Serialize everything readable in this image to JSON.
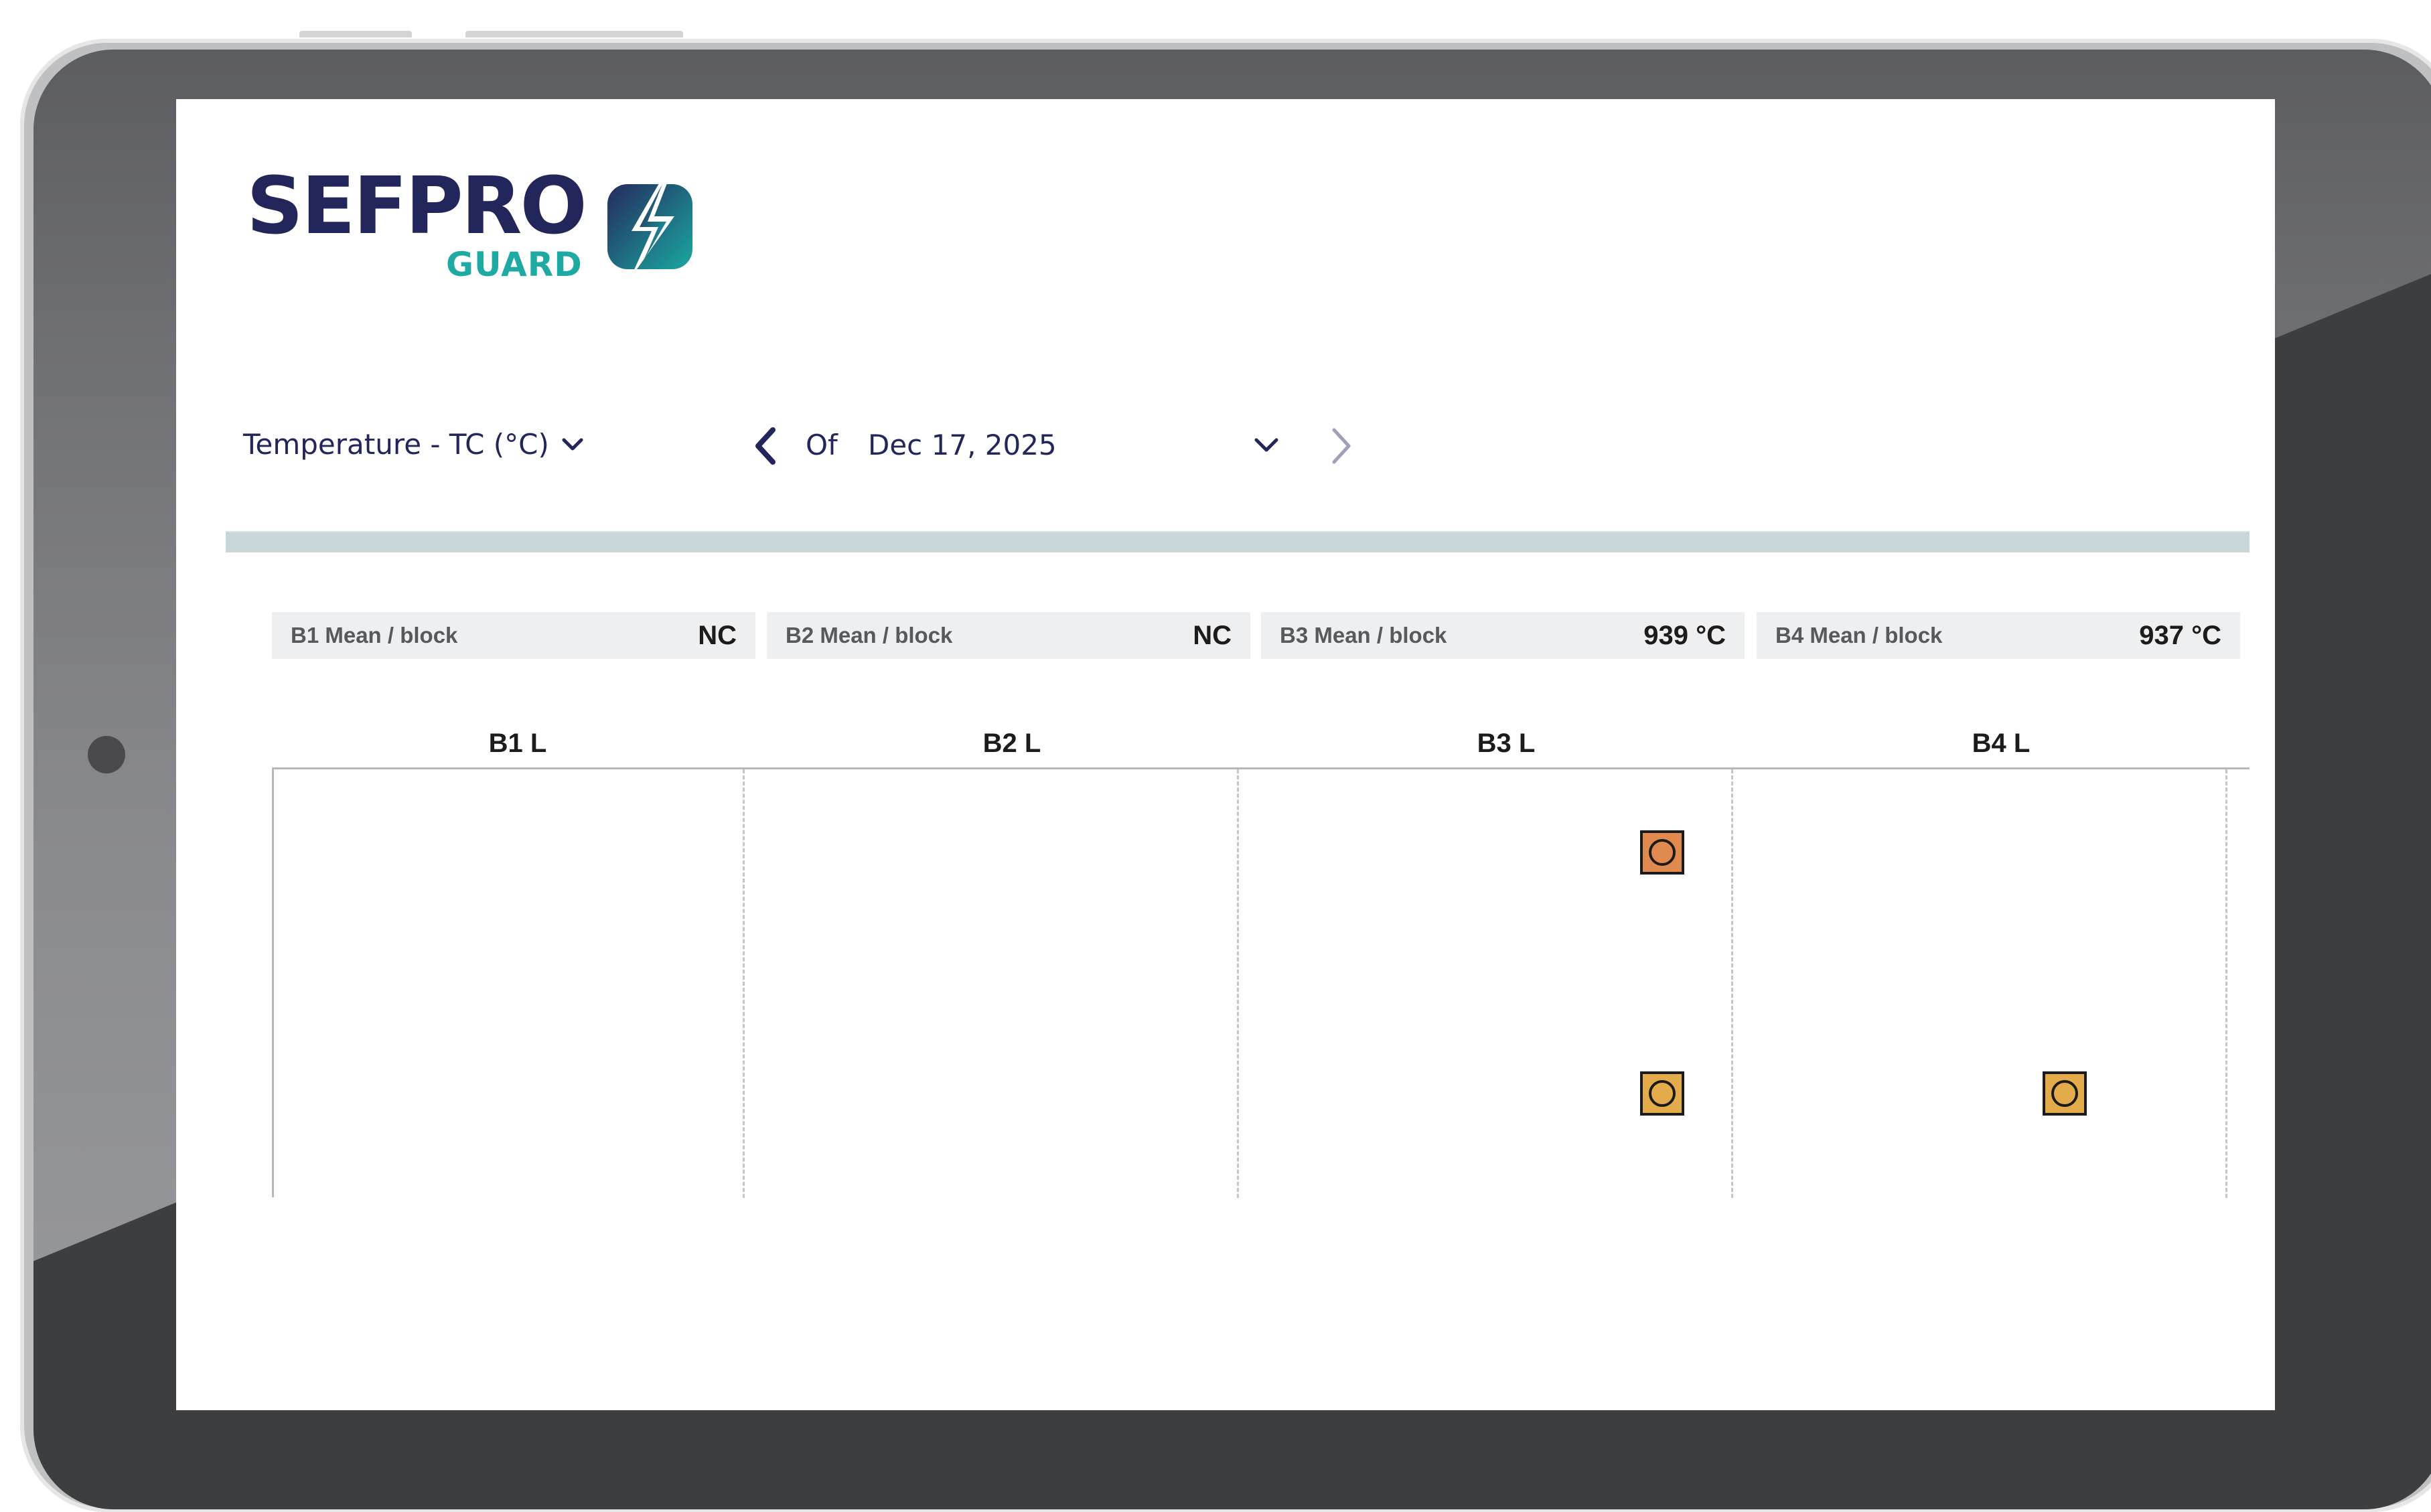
{
  "app": {
    "logo_text": "SEFPRO",
    "logo_sub": "GUARD",
    "brand_color": "#23265a",
    "accent_color": "#1eaaa2"
  },
  "toolbar": {
    "metric_select_label": "Temperature - TC (°C)",
    "date_prefix": "Of",
    "date_value": "Dec 17, 2025",
    "icons": {
      "metric_dropdown": "chevron-down-icon",
      "previous": "chevron-left-icon",
      "date_dropdown": "chevron-down-icon",
      "next": "chevron-right-icon"
    }
  },
  "cards": [
    {
      "label": "B1 Mean / block",
      "value": "NC"
    },
    {
      "label": "B2 Mean / block",
      "value": "NC"
    },
    {
      "label": "B3 Mean / block",
      "value": "939 °C"
    },
    {
      "label": "B4 Mean / block",
      "value": "937 °C"
    }
  ],
  "grid": {
    "columns": [
      "B1 L",
      "B2 L",
      "B3 L",
      "B4 L"
    ],
    "marker_colors": {
      "orange": "#e08a4f",
      "amber": "#e4ab4b"
    },
    "markers": [
      {
        "column": "B3 L",
        "row": 1,
        "color": "orange"
      },
      {
        "column": "B3 L",
        "row": 2,
        "color": "amber"
      },
      {
        "column": "B4 L",
        "row": 2,
        "color": "amber"
      }
    ]
  }
}
